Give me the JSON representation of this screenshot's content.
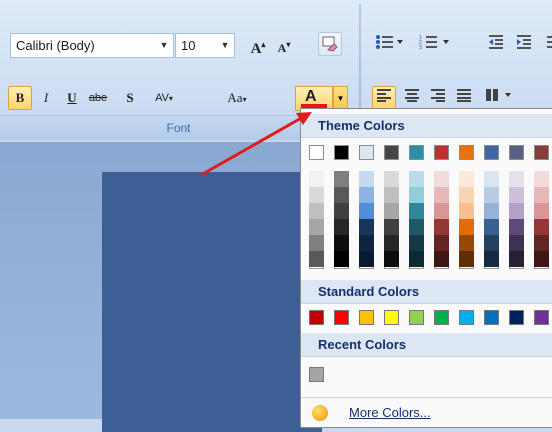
{
  "ribbon": {
    "font_name": "Calibri (Body)",
    "font_size": "10",
    "group_label": "Font",
    "buttons": {
      "grow": "A",
      "shrink": "A",
      "bold": "B",
      "italic": "I",
      "underline": "U",
      "strike": "abe",
      "shadow": "S",
      "spacing": "AV",
      "case": "Aa",
      "font_color_letter": "A"
    }
  },
  "font_color_current": "#ee1111",
  "dropdown": {
    "theme_title": "Theme Colors",
    "standard_title": "Standard Colors",
    "recent_title": "Recent Colors",
    "more_label": "More Colors...",
    "theme_top": [
      "#ffffff",
      "#000000",
      "#dde6f2",
      "#454545",
      "#2b8ea6",
      "#c0302d",
      "#e8730c",
      "#3e66a6",
      "#5a5f86",
      "#8c3a3a"
    ],
    "theme_shades": [
      [
        "#f2f2f2",
        "#d9d9d9",
        "#bfbfbf",
        "#a6a6a6",
        "#7f7f7f",
        "#595959"
      ],
      [
        "#7f7f7f",
        "#595959",
        "#404040",
        "#262626",
        "#0d0d0d",
        "#000000"
      ],
      [
        "#c6d9f1",
        "#8db3e2",
        "#548dd4",
        "#17365d",
        "#0f243e",
        "#0a1a2e"
      ],
      [
        "#d9d9d9",
        "#bfbfbf",
        "#a6a6a6",
        "#404040",
        "#262626",
        "#0d0d0d"
      ],
      [
        "#b7dde8",
        "#92cddc",
        "#31859b",
        "#205867",
        "#123a45",
        "#0d2a33"
      ],
      [
        "#f2dcdb",
        "#e5b9b7",
        "#d99694",
        "#953734",
        "#632423",
        "#3e1615"
      ],
      [
        "#fde9d9",
        "#fbd4b4",
        "#fabf8f",
        "#e36c09",
        "#974806",
        "#5f2e04"
      ],
      [
        "#dbe5f1",
        "#b8cce4",
        "#95b3d7",
        "#366092",
        "#244061",
        "#162a40"
      ],
      [
        "#e5e0ec",
        "#ccc1d9",
        "#b2a2c7",
        "#5f497a",
        "#3f3151",
        "#282033"
      ],
      [
        "#f2dcdb",
        "#e5b9b7",
        "#d99694",
        "#953734",
        "#632423",
        "#3e1615"
      ]
    ],
    "standard": [
      "#c00000",
      "#ff0000",
      "#ffc000",
      "#ffff00",
      "#92d050",
      "#00b050",
      "#00b0f0",
      "#0070c0",
      "#002060",
      "#7030a0"
    ],
    "recent": [
      "#a5a5a5"
    ]
  }
}
